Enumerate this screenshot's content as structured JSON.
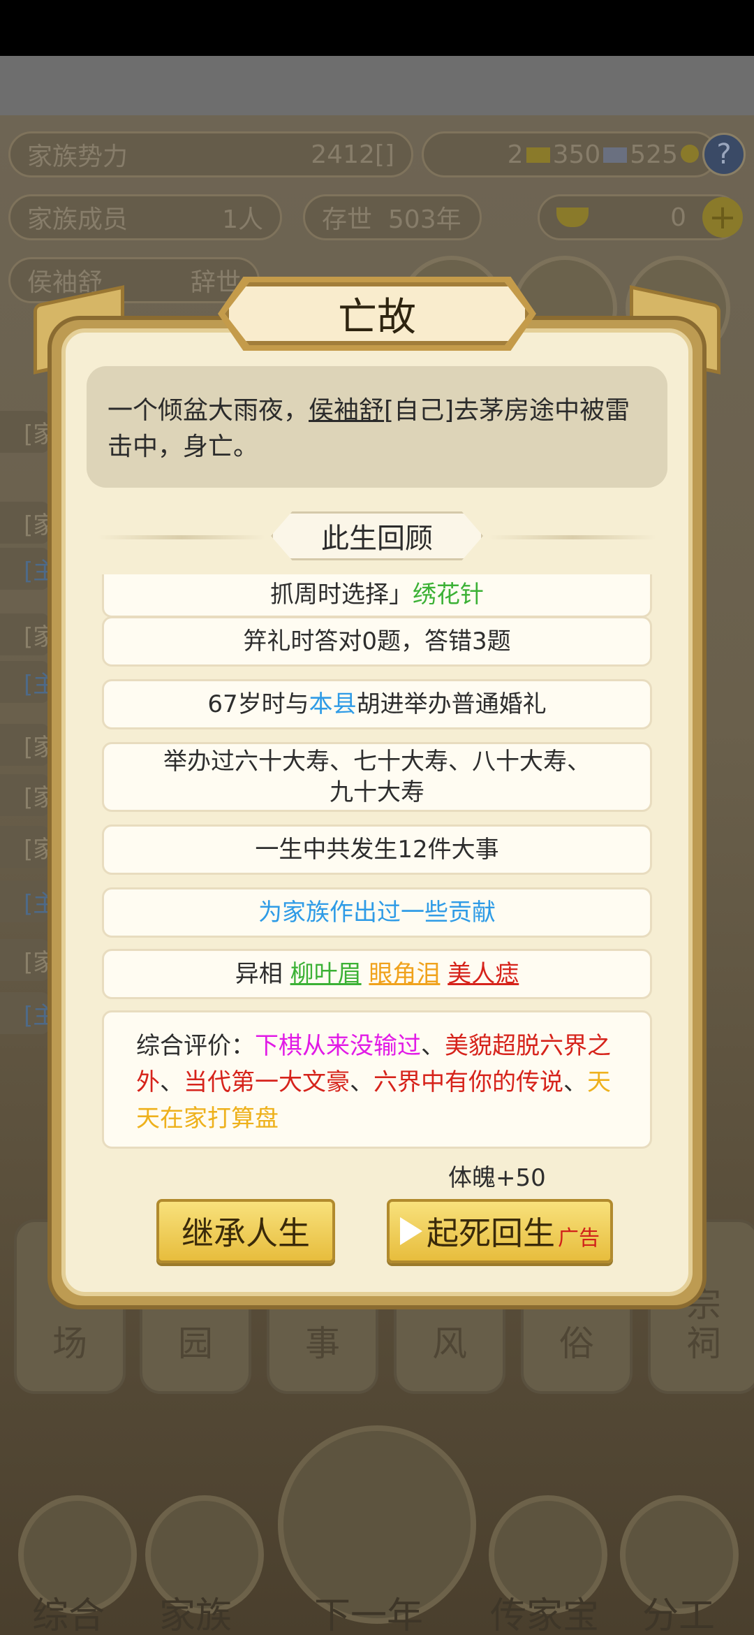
{
  "top_bar": {
    "family_power_label": "家族势力",
    "family_power_value": "2412[",
    "family_power_rank": "",
    "family_power_close": "]",
    "gold_count": "2",
    "silver_count": "350",
    "jade_count": "525",
    "help_glyph": "?",
    "members_label": "家族成员",
    "members_value": "1人",
    "exist_label": "存世",
    "exist_value": "503年",
    "ingot_value": "0",
    "plus_glyph": "+",
    "person_name": "侯袖舒",
    "person_status": "辞世"
  },
  "side_tags": [
    "[家",
    "[家",
    "[主",
    "[家",
    "[主",
    "[家",
    "[家",
    "[家",
    "[主",
    "[家",
    "[主"
  ],
  "dialog": {
    "title": "亡故",
    "death_text_prefix": "一个倾盆大雨夜，",
    "death_name": "侯袖舒",
    "death_text_suffix": "[自己]去茅房途中被雷击中，身亡。",
    "section_title": "此生回顾",
    "items": {
      "grab_prefix": "抓周时选择」",
      "grab_value": "绣花针",
      "ji_li": "笄礼时答对0题，答错3题",
      "wedding_prefix": "67岁时与",
      "wedding_place": "本县",
      "wedding_suffix": "胡进举办普通婚礼",
      "birthday_line1": "举办过六十大寿、七十大寿、八十大寿、",
      "birthday_line2": "九十大寿",
      "events": "一生中共发生12件大事",
      "contribution": "为家族作出过一些贡献",
      "traits_label": "异相",
      "trait1": "柳叶眉",
      "trait2": "眼角泪",
      "trait3": "美人痣"
    },
    "evaluation": {
      "label": "综合评价：",
      "t1": "下棋从来没输过",
      "sep1": "、",
      "t2": "美貌超脱六界之外",
      "sep2": "、",
      "t3": "当代第一大文豪",
      "sep3": "、",
      "t4": "六界中有你的传说",
      "sep4": "、",
      "t5": "天天在家打算盘"
    },
    "bonus": "体魄+50",
    "inherit_button": "继承人生",
    "revive_button": "起死回生",
    "ad_tag": "广告"
  },
  "bg_tiles": [
    {
      "top": "",
      "bottom": "场"
    },
    {
      "top": "",
      "bottom": "园"
    },
    {
      "top": "",
      "bottom": "事"
    },
    {
      "top": "",
      "bottom": "风"
    },
    {
      "top": "",
      "bottom": "俗"
    },
    {
      "top": "宗",
      "bottom": "祠"
    }
  ],
  "bottom_nav": [
    "综合",
    "家族",
    "下一年",
    "传家宝",
    "分工"
  ],
  "colors": {
    "green": "#3bb135",
    "blue": "#2e9be6",
    "orange": "#f0a21c",
    "red": "#d6231b",
    "magenta": "#e11ae6",
    "gold": "#eeb11c"
  }
}
